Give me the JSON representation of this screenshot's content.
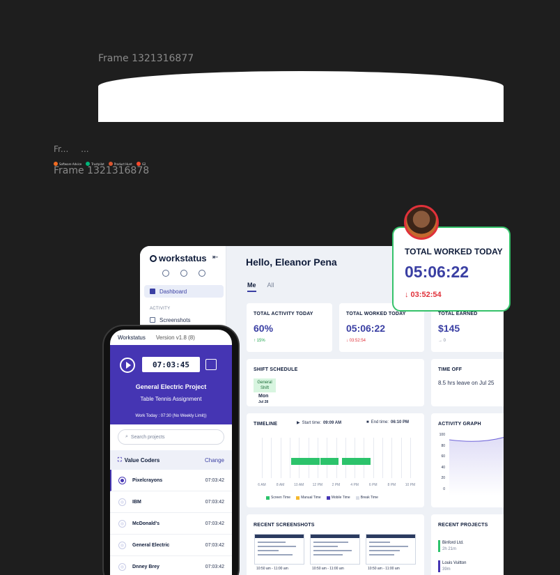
{
  "frames": {
    "frame1": "Frame 1321316877",
    "short1": "Fr...",
    "short2": "...",
    "frame2": "Frame 1321316878"
  },
  "logos": [
    "Software Advice",
    "Trustpilot",
    "Product Hunt",
    "G2"
  ],
  "sidebar": {
    "brand": "workstatus",
    "items": [
      {
        "label": "Dashboard",
        "icon": "dashboard-icon",
        "active": true
      },
      {
        "label": "Screenshots",
        "icon": "screenshot-icon",
        "active": false
      }
    ],
    "section_activity": "ACTIVITY"
  },
  "header": {
    "greeting": "Hello, Eleanor Pena",
    "tabs": [
      {
        "label": "Me",
        "active": true
      },
      {
        "label": "All",
        "active": false
      }
    ]
  },
  "stats": [
    {
      "title": "TOTAL ACTIVITY TODAY",
      "value": "60%",
      "sub": "↑ 15%",
      "sub_color": "#1aa34a"
    },
    {
      "title": "TOTAL WORKED TODAY",
      "value": "05:06:22",
      "sub": "↓ 03:52:54",
      "sub_color": "#e0313a"
    },
    {
      "title": "TOTAL EARNED",
      "value": "$145",
      "sub": "→ 0",
      "sub_color": "#7a849a"
    }
  ],
  "shift": {
    "title": "SHIFT SCHEDULE",
    "chip": "General Shift",
    "day": "Mon",
    "date": "Jul 28"
  },
  "timeoff": {
    "title": "TIME OFF",
    "text": "8.5 hrs leave on Jul 25"
  },
  "timeline": {
    "title": "TIMELINE",
    "start_label": "Start time:",
    "start_value": "09:09 AM",
    "end_label": "End time:",
    "end_value": "06:10 PM",
    "ticks": [
      "6 AM",
      "8 AM",
      "10 AM",
      "12 PM",
      "2 PM",
      "4 PM",
      "6 PM",
      "8 PM",
      "10 PM"
    ],
    "legend": [
      {
        "label": "Screen Time",
        "color": "#2cc36b"
      },
      {
        "label": "Manual Time",
        "color": "#f5b82e"
      },
      {
        "label": "Mobile Time",
        "color": "#4535b3"
      },
      {
        "label": "Break Time",
        "color": "#d9dde6"
      }
    ]
  },
  "activity_graph": {
    "title": "ACTIVITY GRAPH",
    "y_ticks": [
      "100",
      "80",
      "60",
      "40",
      "20",
      "0"
    ]
  },
  "screenshots": {
    "title": "RECENT SCREENSHOTS",
    "caps": [
      "10:50 am - 11:00 am",
      "10:50 am - 11:00 am",
      "10:50 am - 11:00 am"
    ]
  },
  "projects": {
    "title": "RECENT PROJECTS",
    "items": [
      {
        "name": "Binford Ltd.",
        "hours": "2h 21m",
        "color": "#2cc36b"
      },
      {
        "name": "Louis Vuitton",
        "hours": "39m",
        "color": "#4535b3"
      }
    ]
  },
  "popup": {
    "title": "TOTAL WORKED TODAY",
    "time": "05:06:22",
    "sub": "↓ 03:52:54"
  },
  "phone": {
    "app": "Workstatus",
    "version": "Version v1.8 (8)",
    "timer": "07:03:45",
    "project": "General Electric Project",
    "task": "Table Tennis Assignment",
    "work_today": "Work Today : 07:30 (No Weekly Limit))",
    "search_placeholder": "Search projects",
    "org": "Value Coders",
    "change": "Change",
    "rows": [
      {
        "name": "Pixelcrayons",
        "time": "07:03:42"
      },
      {
        "name": "IBM",
        "time": "07:03:42"
      },
      {
        "name": "McDonald's",
        "time": "07:03:42"
      },
      {
        "name": "General Electric",
        "time": "07:03:42"
      },
      {
        "name": "Dnney Brey",
        "time": "07:03:42"
      }
    ]
  }
}
